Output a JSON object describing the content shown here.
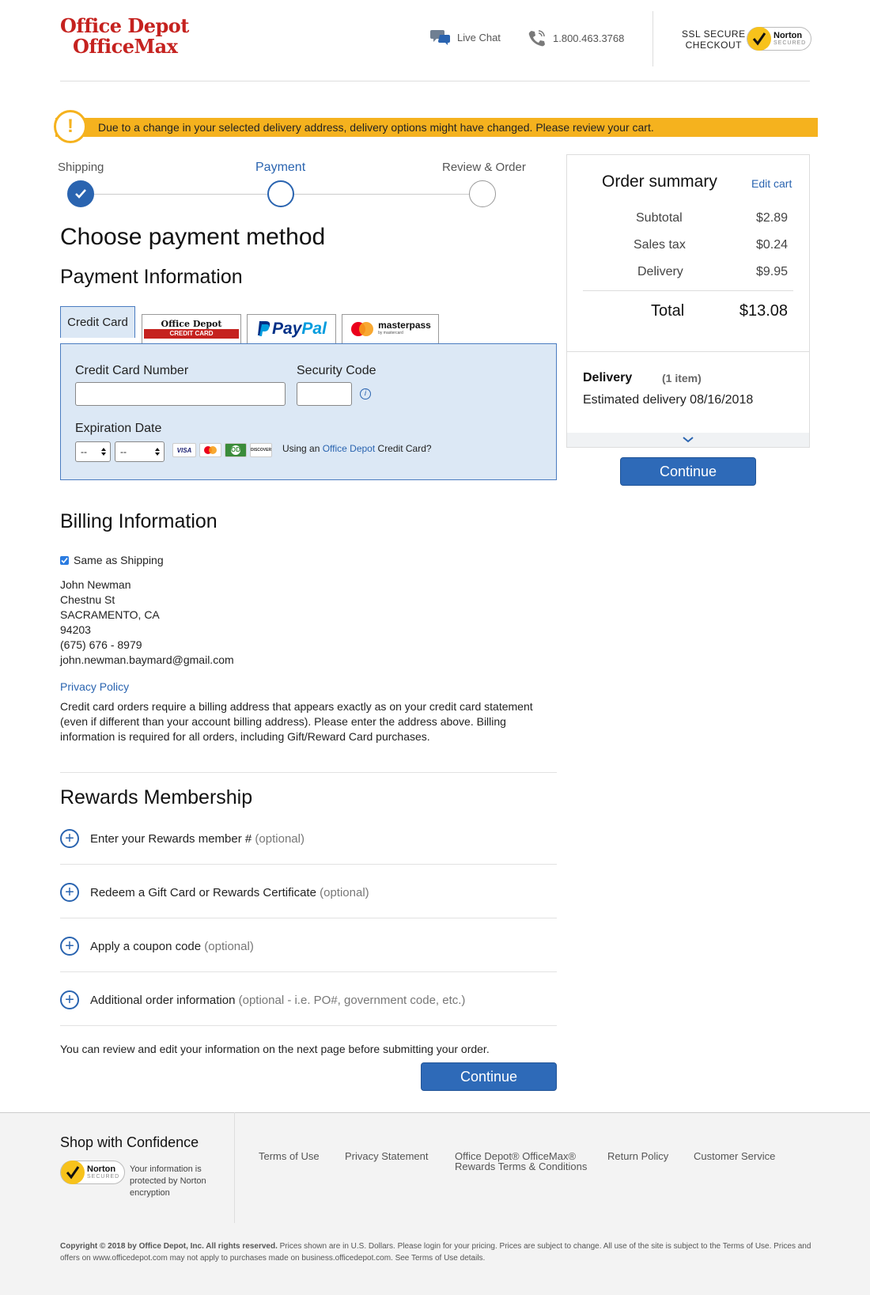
{
  "header": {
    "logo_line1": "Office Depot",
    "logo_line2": "OfficeMax",
    "live_chat": "Live Chat",
    "phone": "1.800.463.3768",
    "ssl_line1": "SSL SECURE",
    "ssl_line2": "CHECKOUT",
    "norton_name": "Norton",
    "norton_secured": "SECURED"
  },
  "alert": {
    "icon": "!",
    "text": "Due to a change in your selected delivery address, delivery options might have changed. Please review your cart."
  },
  "steps": [
    {
      "label": "Shipping",
      "state": "done"
    },
    {
      "label": "Payment",
      "state": "active"
    },
    {
      "label": "Review & Order",
      "state": "todo"
    }
  ],
  "page_title": "Choose payment method",
  "payment_info_title": "Payment Information",
  "payment_tabs": {
    "credit_card": "Credit Card",
    "od_card_line1": "Office Depot",
    "od_card_line2": "CREDIT CARD",
    "paypal_pay": "Pay",
    "paypal_pal": "Pal",
    "masterpass": "masterpass",
    "masterpass_sub": "by mastercard"
  },
  "cc_form": {
    "card_number_label": "Credit Card Number",
    "card_number_value": "",
    "security_code_label": "Security Code",
    "security_code_value": "",
    "info_icon": "i",
    "expiration_label": "Expiration Date",
    "month_value": "--",
    "year_value": "--",
    "card_brands": [
      "VISA",
      "MC",
      "OD",
      "DISCOVER"
    ],
    "od_question_prefix": "Using an ",
    "od_question_link": "Office Depot",
    "od_question_suffix": " Credit Card?"
  },
  "billing": {
    "title": "Billing Information",
    "same_as_shipping_label": "Same as Shipping",
    "same_as_shipping_checked": true,
    "address": [
      "John Newman",
      "Chestnu St",
      "SACRAMENTO, CA",
      "94203",
      "(675) 676 - 8979",
      "john.newman.baymard@gmail.com"
    ],
    "privacy_link": "Privacy Policy",
    "notice": "Credit card orders require a billing address that appears exactly as on your credit card statement (even if different than your account billing address). Please enter the address above. Billing information is required for all orders, including Gift/Reward Card purchases."
  },
  "rewards": {
    "title": "Rewards Membership",
    "rows": [
      {
        "label": "Enter your Rewards member #",
        "note": "(optional)"
      },
      {
        "label": "Redeem a Gift Card or Rewards Certificate",
        "note": "(optional)"
      },
      {
        "label": "Apply a coupon code",
        "note": "(optional)"
      },
      {
        "label": "Additional order information",
        "note": "(optional - i.e. PO#, government code, etc.)"
      }
    ]
  },
  "review_note": "You can review and edit your information on the next page before submitting your order.",
  "continue_label": "Continue",
  "summary": {
    "title": "Order summary",
    "edit_cart": "Edit cart",
    "subtotal_label": "Subtotal",
    "subtotal": "$2.89",
    "tax_label": "Sales tax",
    "tax": "$0.24",
    "delivery_label": "Delivery",
    "delivery": "$9.95",
    "total_label": "Total",
    "total": "$13.08",
    "delivery_heading": "Delivery",
    "item_count": "(1 item)",
    "estimated": "Estimated delivery 08/16/2018"
  },
  "footer": {
    "confidence_title": "Shop with Confidence",
    "norton_text": "Your information is protected by Norton encryption",
    "links": [
      "Terms of Use",
      "Privacy Statement",
      "Office Depot® OfficeMax® Rewards Terms & Conditions",
      "Return Policy",
      "Customer Service"
    ],
    "copyright_bold": "Copyright © 2018 by Office Depot, Inc. All rights reserved.",
    "copyright_rest": " Prices shown are in U.S. Dollars. Please login for your pricing. Prices are subject to change. All use of the site is subject to the Terms of Use. Prices and offers on www.officedepot.com may not apply to purchases made on business.officedepot.com. See Terms of Use details."
  },
  "colors": {
    "brand_red": "#c5221f",
    "accent_blue": "#2a64b0",
    "alert_yellow": "#f5b21e"
  }
}
